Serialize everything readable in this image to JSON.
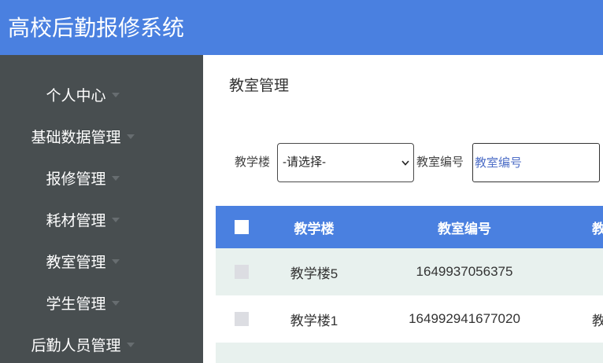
{
  "app": {
    "title": "高校后勤报修系统"
  },
  "colors": {
    "primary": "#4a80e0",
    "sidebar_bg": "#484e50",
    "sidebar_text": "#ffffff",
    "row_alt": "#e8f1ee",
    "caret": "#676d70"
  },
  "sidebar": {
    "items": [
      {
        "label": "个人中心",
        "icon": "caret-down-icon"
      },
      {
        "label": "基础数据管理",
        "icon": "caret-down-icon"
      },
      {
        "label": "报修管理",
        "icon": "caret-down-icon"
      },
      {
        "label": "耗材管理",
        "icon": "caret-down-icon"
      },
      {
        "label": "教室管理",
        "icon": "caret-down-icon"
      },
      {
        "label": "学生管理",
        "icon": "caret-down-icon"
      },
      {
        "label": "后勤人员管理",
        "icon": "caret-down-icon"
      }
    ]
  },
  "page": {
    "title": "教室管理"
  },
  "filters": {
    "building": {
      "label": "教学楼",
      "selected": "-请选择-",
      "icon": "chevron-down-icon"
    },
    "room_no": {
      "label": "教室编号",
      "placeholder": "教室编号"
    }
  },
  "table": {
    "columns": [
      "教学楼",
      "教室编号",
      "教"
    ],
    "rows": [
      {
        "building": "教学楼5",
        "room_no": "1649937056375"
      },
      {
        "building": "教学楼1",
        "room_no": "164992941677020",
        "col3": "教"
      }
    ]
  }
}
